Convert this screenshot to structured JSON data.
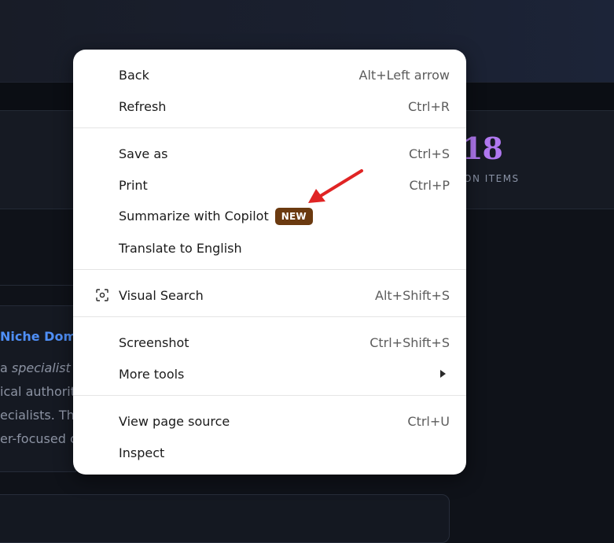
{
  "background": {
    "stat_value": "18",
    "stat_label": "ON ITEMS",
    "card_title": "Niche Dom",
    "card_lines": [
      {
        "text": "a ",
        "italic_text": "specialist"
      },
      {
        "text": "ical authorit"
      },
      {
        "text": "ecialists. The"
      },
      {
        "text": "er-focused c"
      }
    ]
  },
  "context_menu": {
    "items": [
      {
        "label": "Back",
        "shortcut": "Alt+Left arrow"
      },
      {
        "label": "Refresh",
        "shortcut": "Ctrl+R"
      },
      {
        "label": "Save as",
        "shortcut": "Ctrl+S"
      },
      {
        "label": "Print",
        "shortcut": "Ctrl+P"
      },
      {
        "label": "Summarize with Copilot",
        "badge": "NEW"
      },
      {
        "label": "Translate to English"
      },
      {
        "label": "Visual Search",
        "shortcut": "Alt+Shift+S",
        "icon": "visual-search-icon"
      },
      {
        "label": "Screenshot",
        "shortcut": "Ctrl+Shift+S"
      },
      {
        "label": "More tools",
        "icon": "chevron-right-icon"
      },
      {
        "label": "View page source",
        "shortcut": "Ctrl+U"
      },
      {
        "label": "Inspect"
      }
    ]
  },
  "colors": {
    "badge_bg": "#6b3a10",
    "annotation_arrow": "#e02424",
    "stat_accent": "#b078f0",
    "link_accent": "#4f8ff7"
  }
}
